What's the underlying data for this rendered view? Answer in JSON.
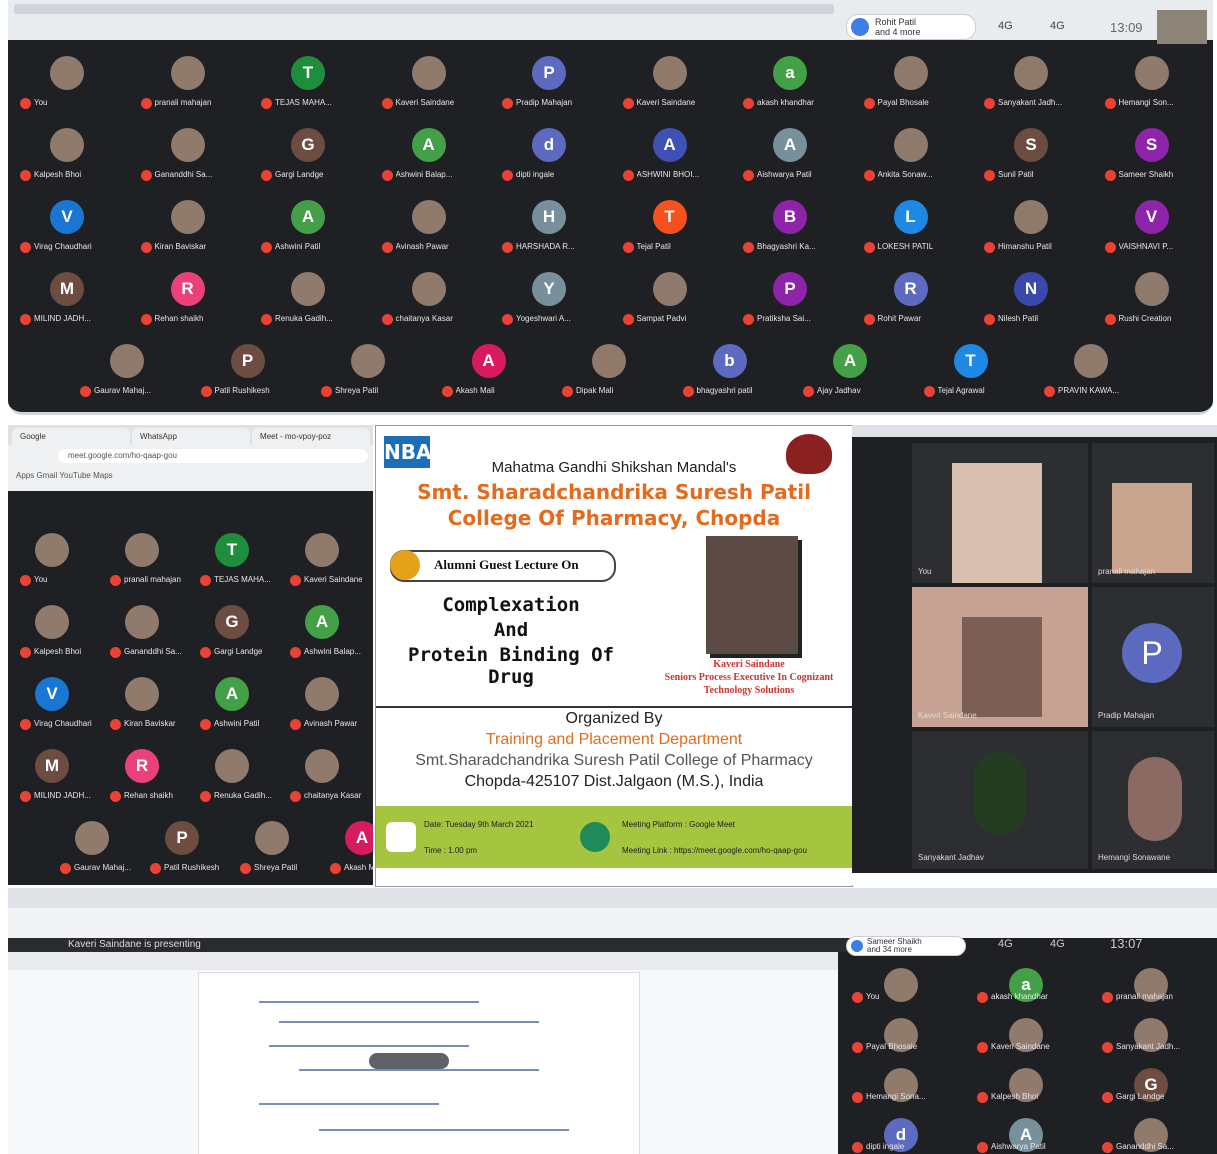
{
  "top_meeting": {
    "presenter_pill": "Rohit Patil",
    "presenter_pill_sub": "and 4 more",
    "signal1": "4G",
    "signal2": "4G",
    "clock": "13:09",
    "rows": [
      [
        {
          "name": "You",
          "photo": true
        },
        {
          "name": "pranali mahajan",
          "photo": true
        },
        {
          "name": "TEJAS MAHA...",
          "letter": "T",
          "color": "#1e8e3e"
        },
        {
          "name": "Kaveri Saindane",
          "photo": true
        },
        {
          "name": "Pradip Mahajan",
          "letter": "P",
          "color": "#5c6bc0"
        },
        {
          "name": "Kaveri Saindane",
          "photo": true
        },
        {
          "name": "akash khandhar",
          "letter": "a",
          "color": "#43a047"
        },
        {
          "name": "Payal Bhosale",
          "photo": true
        },
        {
          "name": "Sanyakant Jadh...",
          "photo": true
        },
        {
          "name": "Hemangi Son...",
          "photo": true
        }
      ],
      [
        {
          "name": "Kalpesh Bhoi",
          "photo": true
        },
        {
          "name": "Gananddhi Sa...",
          "photo": true
        },
        {
          "name": "Gargi Landge",
          "letter": "G",
          "color": "#6d4c41"
        },
        {
          "name": "Ashwini Balap...",
          "letter": "A",
          "color": "#43a047"
        },
        {
          "name": "dipti ingale",
          "letter": "d",
          "color": "#5c6bc0"
        },
        {
          "name": "ASHWINI BHOI...",
          "letter": "A",
          "color": "#3f51b5"
        },
        {
          "name": "Aishwarya Patil",
          "letter": "A",
          "color": "#78909c"
        },
        {
          "name": "Ankita Sonaw...",
          "photo": true
        },
        {
          "name": "Sunil Patil",
          "letter": "S",
          "color": "#6d4c41"
        },
        {
          "name": "Sameer Shaikh",
          "letter": "S",
          "color": "#8e24aa"
        }
      ],
      [
        {
          "name": "Virag Chaudhari",
          "letter": "V",
          "color": "#1976d2"
        },
        {
          "name": "Kiran Baviskar",
          "photo": true
        },
        {
          "name": "Ashwini Patil",
          "letter": "A",
          "color": "#43a047"
        },
        {
          "name": "Avinash Pawar",
          "photo": true
        },
        {
          "name": "HARSHADA R...",
          "letter": "H",
          "color": "#78909c"
        },
        {
          "name": "Tejal Patil",
          "letter": "T",
          "color": "#f4511e"
        },
        {
          "name": "Bhagyashri Ka...",
          "letter": "B",
          "color": "#8e24aa"
        },
        {
          "name": "LOKESH PATIL",
          "letter": "L",
          "color": "#1e88e5"
        },
        {
          "name": "Himanshu Patil",
          "photo": true
        },
        {
          "name": "VAISHNAVI P...",
          "letter": "V",
          "color": "#8e24aa"
        }
      ],
      [
        {
          "name": "MILIND JADH...",
          "letter": "M",
          "color": "#6d4c41"
        },
        {
          "name": "Rehan shaikh",
          "letter": "R",
          "color": "#ec407a"
        },
        {
          "name": "Renuka Gadih...",
          "photo": true
        },
        {
          "name": "chaitanya Kasar",
          "photo": true
        },
        {
          "name": "Yogeshwari A...",
          "letter": "Y",
          "color": "#78909c"
        },
        {
          "name": "Sampat Padvi",
          "photo": true
        },
        {
          "name": "Pratiksha Sai...",
          "letter": "P",
          "color": "#8e24aa"
        },
        {
          "name": "Rohit Pawar",
          "letter": "R",
          "color": "#5c6bc0"
        },
        {
          "name": "Nilesh Patil",
          "letter": "N",
          "color": "#3949ab"
        },
        {
          "name": "Rushi Creation",
          "photo": true
        }
      ],
      [
        {
          "name": "Gaurav Mahaj...",
          "photo": true
        },
        {
          "name": "Patil Rushikesh",
          "letter": "P",
          "color": "#6d4c41"
        },
        {
          "name": "Shreya Patil",
          "photo": true
        },
        {
          "name": "Akash Mali",
          "letter": "A",
          "color": "#d81b60"
        },
        {
          "name": "Dipak Mali",
          "photo": true
        },
        {
          "name": "bhagyashri patil",
          "letter": "b",
          "color": "#5c6bc0"
        },
        {
          "name": "Ajay Jadhav",
          "letter": "A",
          "color": "#43a047"
        },
        {
          "name": "Tejal Agrawal",
          "letter": "T",
          "color": "#1e88e5"
        },
        {
          "name": "PRAVIN KAWA...",
          "photo": true
        }
      ]
    ]
  },
  "mid_left": {
    "tab1": "Google",
    "tab2": "WhatsApp",
    "tab3": "Meet - mo-vpoy-poz",
    "url": "meet.google.com/ho-qaap-gou",
    "bookmarks": "Apps   Gmail   YouTube   Maps",
    "rows": [
      [
        {
          "name": "You",
          "photo": true
        },
        {
          "name": "pranali mahajan",
          "photo": true
        },
        {
          "name": "TEJAS MAHA...",
          "letter": "T",
          "color": "#1e8e3e"
        },
        {
          "name": "Kaveri Saindane",
          "photo": true
        }
      ],
      [
        {
          "name": "Kalpesh Bhoi",
          "photo": true
        },
        {
          "name": "Gananddhi Sa...",
          "photo": true
        },
        {
          "name": "Gargi Landge",
          "letter": "G",
          "color": "#6d4c41"
        },
        {
          "name": "Ashwini Balap...",
          "letter": "A",
          "color": "#43a047"
        }
      ],
      [
        {
          "name": "Virag Chaudhari",
          "letter": "V",
          "color": "#1976d2"
        },
        {
          "name": "Kiran Baviskar",
          "photo": true
        },
        {
          "name": "Ashwini Patil",
          "letter": "A",
          "color": "#43a047"
        },
        {
          "name": "Avinash Pawar",
          "photo": true
        }
      ],
      [
        {
          "name": "MILIND JADH...",
          "letter": "M",
          "color": "#6d4c41"
        },
        {
          "name": "Rehan shaikh",
          "letter": "R",
          "color": "#ec407a"
        },
        {
          "name": "Renuka Gadih...",
          "photo": true
        },
        {
          "name": "chaitanya Kasar",
          "photo": true
        }
      ],
      [
        {
          "name": "Gaurav Mahaj...",
          "photo": true
        },
        {
          "name": "Patil Rushikesh",
          "letter": "P",
          "color": "#6d4c41"
        },
        {
          "name": "Shreya Patil",
          "photo": true
        },
        {
          "name": "Akash Mali",
          "letter": "A",
          "color": "#d81b60"
        }
      ]
    ]
  },
  "poster": {
    "logo": "NBA",
    "mandal": "Mahatma Gandhi Shikshan Mandal's",
    "college_line1": "Smt. Sharadchandrika Suresh Patil",
    "college_line2": "College Of Pharmacy, Chopda",
    "badge": "Alumni Guest Lecture On",
    "topic1": "Complexation",
    "topic2": "And",
    "topic3": "Protein Binding Of Drug",
    "speaker_name": "Kaveri Saindane",
    "speaker_role1": "Seniors Process Executive In Cognizant",
    "speaker_role2": "Technology Solutions",
    "organized_by": "Organized By",
    "department": "Training and Placement Department",
    "org_college": "Smt.Sharadchandrika Suresh Patil College of Pharmacy",
    "address": "Chopda-425107 Dist.Jalgaon (M.S.), India",
    "date": "Date: Tuesday 9th March 2021",
    "time": "Time : 1.00 pm",
    "platform": "Meeting Platform : Google Meet",
    "link": "Meeting Link : https://meet.google.com/ho-qaap-gou"
  },
  "mid_right": {
    "t1": "You",
    "t2": "pranali mahajan",
    "t3": "Kaveri Saindane",
    "t4": "Pradip Mahajan",
    "t4_letter": "P",
    "t5": "Sanyakant Jadhav",
    "t6": "Hemangi Sonawane"
  },
  "bottom": {
    "presenting": "Kaveri Saindane is presenting",
    "pill": "Sameer Shaikh",
    "pill_sub": "and 34 more",
    "signal1": "4G",
    "signal2": "4G",
    "clock": "13:07",
    "side_tiles": [
      {
        "name": "You",
        "photo": true
      },
      {
        "name": "akash khandhar",
        "letter": "a",
        "color": "#43a047"
      },
      {
        "name": "pranali mahajan",
        "photo": true
      },
      {
        "name": "Payal Bhosale",
        "photo": true
      },
      {
        "name": "Kaveri Saindane",
        "photo": true
      },
      {
        "name": "Sanyakant Jadh...",
        "photo": true
      },
      {
        "name": "Hemangi Sona...",
        "photo": true
      },
      {
        "name": "Kalpesh Bhoi",
        "photo": true
      },
      {
        "name": "Gargi Landge",
        "letter": "G",
        "color": "#6d4c41"
      },
      {
        "name": "dipti ingale",
        "letter": "d",
        "color": "#5c6bc0"
      },
      {
        "name": "Aishwarya Patil",
        "letter": "A",
        "color": "#78909c"
      },
      {
        "name": "Gananddhi Sa...",
        "photo": true
      }
    ]
  }
}
